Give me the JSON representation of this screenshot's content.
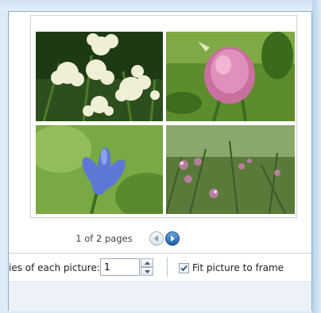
{
  "preview": {
    "photos": [
      {
        "name": "yarrow-photo",
        "subject": "white yarrow flowers"
      },
      {
        "name": "clover-photo",
        "subject": "pink clover flower"
      },
      {
        "name": "chicory-photo",
        "subject": "blue chicory flower"
      },
      {
        "name": "meadow-photo",
        "subject": "pink meadow flowers"
      }
    ]
  },
  "navigation": {
    "page_count": "1 of 2 pages",
    "prev_icon": "back-arrow-icon",
    "next_icon": "forward-arrow-icon"
  },
  "options": {
    "copies_label": "ies of each picture:",
    "copies_value": "1",
    "fit_label": "Fit picture to frame",
    "fit_checked": true
  },
  "colors": {
    "next_button": "#1f5ea5",
    "window_border": "#8ea9c4"
  }
}
